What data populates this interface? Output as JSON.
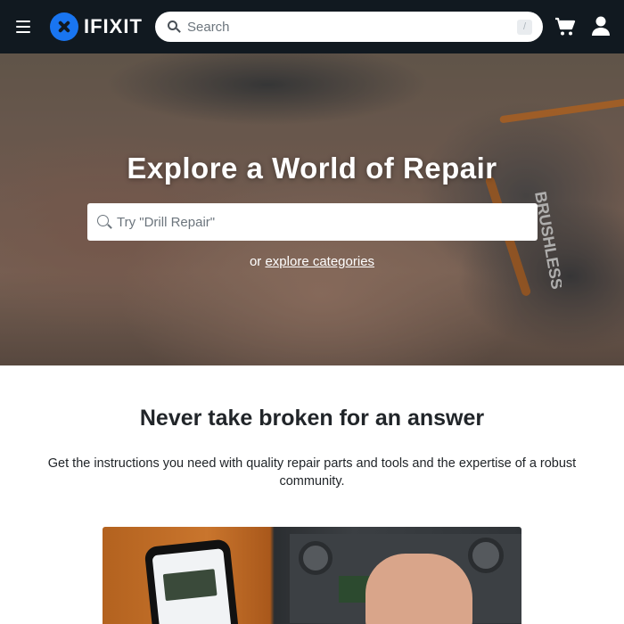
{
  "nav": {
    "logo_text": "IFIXIT",
    "search_placeholder": "Search",
    "search_shortcut": "/"
  },
  "hero": {
    "title": "Explore a World of Repair",
    "search_placeholder": "Try \"Drill Repair\"",
    "sub_prefix": "or",
    "sub_link": "explore categories",
    "image_label": "BRUSHLESS"
  },
  "section": {
    "title": "Never take broken for an answer",
    "description": "Get the instructions you need with quality repair parts and tools and the expertise of a robust community."
  },
  "icons": {
    "menu": "hamburger-menu-icon",
    "logo": "ifixit-logo-icon",
    "search": "search-icon",
    "cart": "shopping-cart-icon",
    "user": "user-icon"
  },
  "colors": {
    "nav_background": "#111920",
    "brand_blue": "#1975f1",
    "accent_orange": "#d97a2a"
  }
}
